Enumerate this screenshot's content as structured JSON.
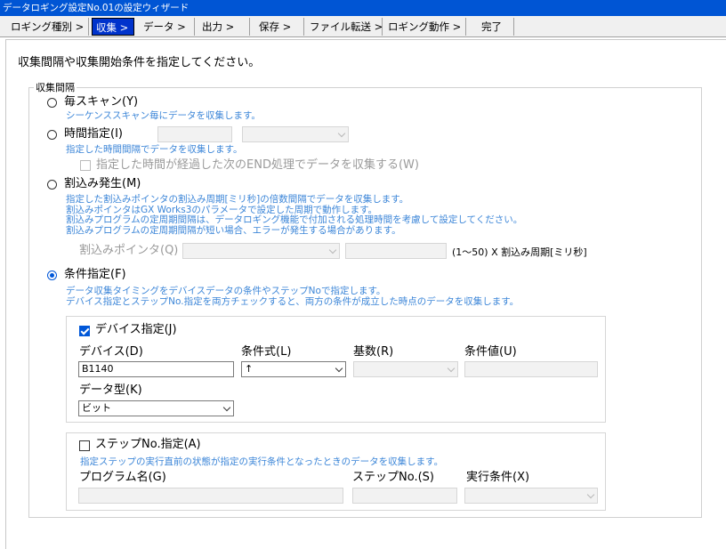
{
  "window": {
    "title": "データロギング設定No.01の設定ウィザード"
  },
  "tabs": [
    {
      "label": "ロギング種別 >"
    },
    {
      "label": "収集 >"
    },
    {
      "label": "データ >"
    },
    {
      "label": "出力 >"
    },
    {
      "label": "保存 >"
    },
    {
      "label": "ファイル転送 >"
    },
    {
      "label": "ロギング動作 >"
    },
    {
      "label": "完了"
    }
  ],
  "active_tab": "収集 >",
  "instruction": "収集間隔や収集開始条件を指定してください。",
  "interval_group": {
    "title": "収集間隔",
    "every_scan": {
      "label": "毎スキャン(Y)",
      "desc": "シーケンススキャン毎にデータを収集します。"
    },
    "time_spec": {
      "label": "時間指定(I)",
      "desc": "指定した時間間隔でデータを収集します。",
      "end_check_label": "指定した時間が経過した次のEND処理でデータを収集する(W)"
    },
    "interrupt": {
      "label": "割込み発生(M)",
      "desc": [
        "指定した割込みポインタの割込み周期[ミリ秒]の倍数間隔でデータを収集します。",
        "割込みポインタはGX Works3のパラメータで設定した周期で動作します。",
        "割込みプログラムの定周期間隔は、データロギング機能で付加される処理時間を考慮して設定してください。",
        "割込みプログラムの定周期間隔が短い場合、エラーが発生する場合があります。"
      ],
      "pointer_label": "割込みポインタ(Q)",
      "multiplier_label": "(1〜50) X 割込み周期[ミリ秒]"
    },
    "condition": {
      "label": "条件指定(F)",
      "selected": true,
      "desc": [
        "データ収集タイミングをデバイスデータの条件やステップNoで指定します。",
        "デバイス指定とステップNo.指定を両方チェックすると、両方の条件が成立した時点のデータを収集します。"
      ]
    }
  },
  "device_spec": {
    "label": "デバイス指定(J)",
    "checked": true,
    "device_label": "デバイス(D)",
    "device_value": "B1140",
    "cond_label": "条件式(L)",
    "cond_value": "↑",
    "radix_label": "基数(R)",
    "cond_value_label": "条件値(U)",
    "datatype_label": "データ型(K)",
    "datatype_value": "ビット"
  },
  "step_spec": {
    "label": "ステップNo.指定(A)",
    "checked": false,
    "desc": "指定ステップの実行直前の状態が指定の実行条件となったときのデータを収集します。",
    "program_label": "プログラム名(G)",
    "step_label": "ステップNo.(S)",
    "exec_label": "実行条件(X)"
  },
  "colors": {
    "title_bar": "#0055d4",
    "active_tab": "#0033cc",
    "description_text": "#3c86d8",
    "radio_selected": "#0057d8"
  }
}
